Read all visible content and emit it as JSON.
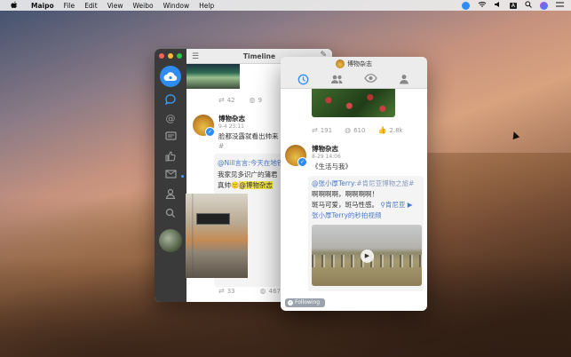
{
  "menubar": {
    "apple": "",
    "app_name": "Maipo",
    "menus": [
      "File",
      "Edit",
      "View",
      "Weibo",
      "Window",
      "Help"
    ],
    "status_icons": [
      "creative-cloud-icon",
      "wifi-icon",
      "volume-icon",
      "input-source-icon",
      "spotlight-icon",
      "siri-icon",
      "control-icon"
    ],
    "input_source": "A"
  },
  "main_window": {
    "title": "Timeline",
    "sidebar_icons": [
      "chat-bubble-icon",
      "mention-icon",
      "comment-icon",
      "like-icon",
      "mail-icon",
      "user-icon",
      "search-icon"
    ],
    "top_post": {
      "reposts": "42",
      "comments": "9"
    },
    "post": {
      "name": "博物杂志",
      "time": "9-4 23:11",
      "text_line1": "脸都没露就看出帅来",
      "text_line2": "#",
      "repost_line1": "@Nill言言:今天在地铁",
      "repost_line2": "我家见多识广的蒲君",
      "repost_line3_prefix": "真帅",
      "repost_mention": "@博物杂志",
      "reposts": "33",
      "comments": "467"
    }
  },
  "detail_window": {
    "title": "博物杂志",
    "tabs": [
      "clock-icon",
      "friends-icon",
      "eye-icon",
      "profile-icon"
    ],
    "top_post": {
      "reposts": "191",
      "comments": "610",
      "likes": "2.8k"
    },
    "post": {
      "name": "博物杂志",
      "time": "8-29 14:06",
      "text": "《生活与我》",
      "repost_mention": "@张小厚Terry",
      "repost_topic": ":#肯尼亚博物之旅#",
      "repost_line2": "啊啊啊啊，啊啊啊啊！",
      "repost_line3": "斑马可爱，斑马性感。",
      "location": "肯尼亚",
      "repost_line4": "张小厚Terry的秒拍视频"
    },
    "following_label": "Following"
  },
  "colors": {
    "accent": "#2f8cf2",
    "sidebar_bg": "#3a3a3a",
    "mention": "#4a79c9",
    "highlight": "#f4e54a"
  }
}
